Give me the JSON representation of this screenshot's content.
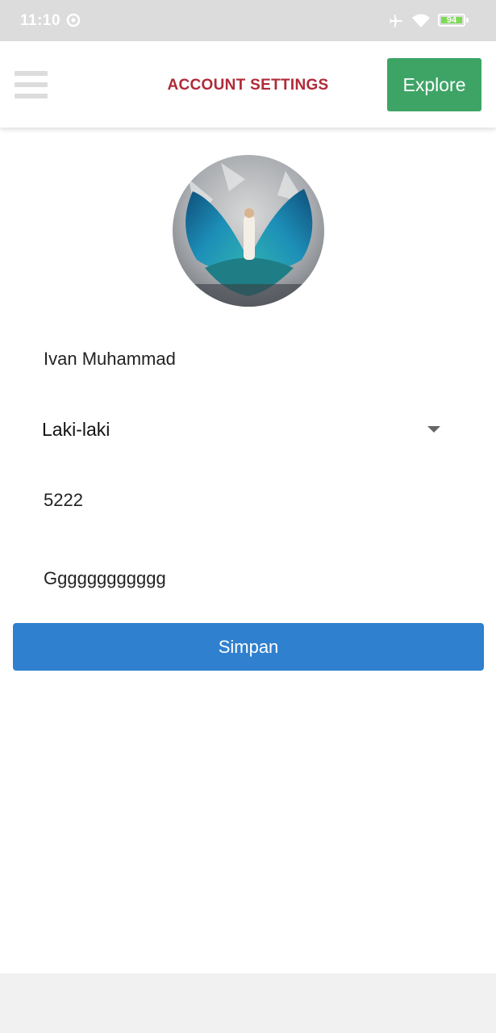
{
  "status_bar": {
    "time": "11:10",
    "battery_level": "94",
    "battery_fraction": 0.94,
    "icons": [
      "sync-circle-icon",
      "airplane-icon",
      "wifi-icon",
      "battery-icon"
    ]
  },
  "app_bar": {
    "menu_icon": "hamburger-menu-icon",
    "title": "ACCOUNT SETTINGS",
    "explore_label": "Explore"
  },
  "profile": {
    "avatar": "profile-picture"
  },
  "form": {
    "name_value": "Ivan Muhammad",
    "gender_value": "Laki-laki",
    "number_value": "5222",
    "text_value": "Gggggggggggg",
    "save_label": "Simpan"
  },
  "colors": {
    "title": "#b02a37",
    "explore_button": "#3ea466",
    "save_button": "#2f80ce",
    "status_bar": "#dcdcdc"
  }
}
